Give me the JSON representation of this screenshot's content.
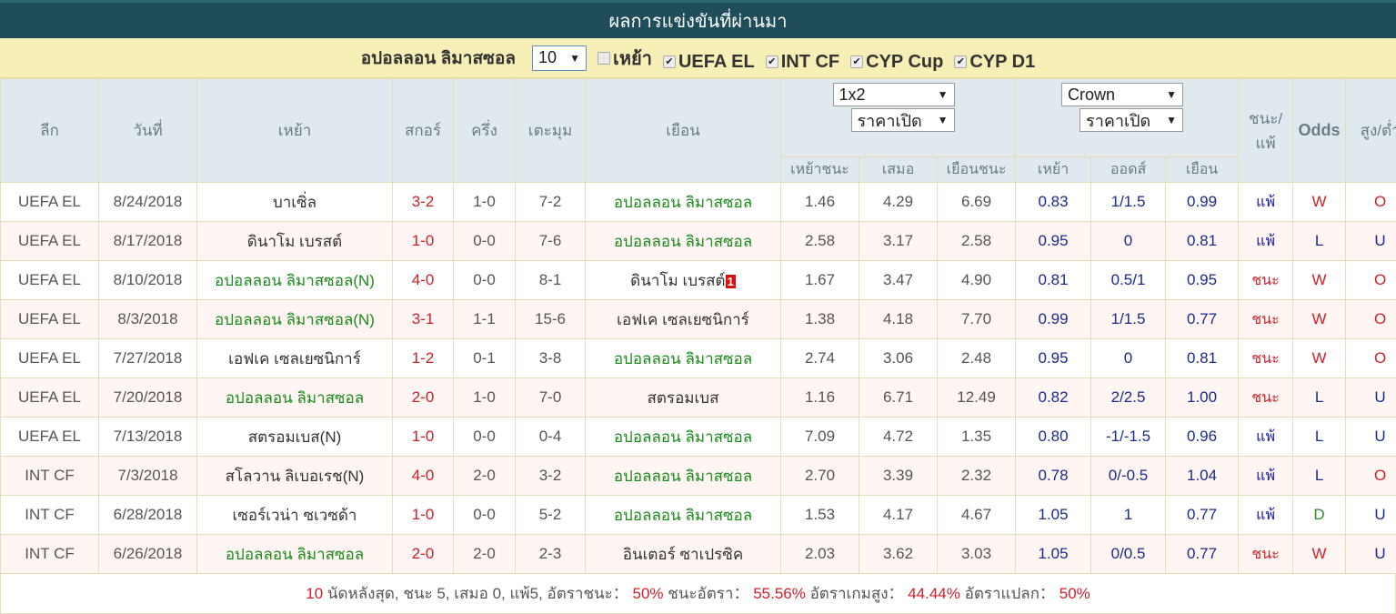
{
  "title": "ผลการแข่งขันที่ผ่านมา",
  "filter": {
    "team": "อปอลลอน ลิมาสซอล",
    "count_value": "10",
    "checkboxes": [
      {
        "label": "เหย้า",
        "checked": false
      },
      {
        "label": "UEFA EL",
        "checked": true
      },
      {
        "label": "INT CF",
        "checked": true
      },
      {
        "label": "CYP Cup",
        "checked": true
      },
      {
        "label": "CYP D1",
        "checked": true
      }
    ]
  },
  "header": {
    "league": "ลีก",
    "date": "วันที่",
    "home": "เหย้า",
    "score": "สกอร์",
    "half": "ครึ่ง",
    "corners": "เตะมุม",
    "away": "เยือน",
    "odds_select_1": "1x2",
    "odds_select_1b": "ราคาเปิด",
    "odds_select_2": "Crown",
    "odds_select_2b": "ราคาเปิด",
    "win_lose": "ชนะ/แพ้",
    "odds": "Odds",
    "over_under": "สูง/ต่ำ",
    "sub": [
      "เหย้าชนะ",
      "เสมอ",
      "เยือนชนะ",
      "เหย้า",
      "ออดส์",
      "เยือน"
    ]
  },
  "rows": [
    {
      "league": "UEFA EL",
      "date": "8/24/2018",
      "home": "บาเซิ่ล",
      "home_hl": false,
      "score": "3-2",
      "half": "1-0",
      "corners": "7-2",
      "away": "อปอลลอน ลิมาสซอล",
      "away_hl": true,
      "badge": "",
      "h": "1.46",
      "d": "4.29",
      "a": "6.69",
      "ah_h": "0.83",
      "ah": "1/1.5",
      "ah_a": "0.99",
      "wl": "แพ้",
      "wl_type": "lose",
      "odds_res": "W",
      "ou": "O"
    },
    {
      "league": "UEFA EL",
      "date": "8/17/2018",
      "home": "ดินาโม เบรสต์",
      "home_hl": false,
      "score": "1-0",
      "half": "0-0",
      "corners": "7-6",
      "away": "อปอลลอน ลิมาสซอล",
      "away_hl": true,
      "badge": "",
      "h": "2.58",
      "d": "3.17",
      "a": "2.58",
      "ah_h": "0.95",
      "ah": "0",
      "ah_a": "0.81",
      "wl": "แพ้",
      "wl_type": "lose",
      "odds_res": "L",
      "ou": "U"
    },
    {
      "league": "UEFA EL",
      "date": "8/10/2018",
      "home": "อปอลลอน ลิมาสซอล(N)",
      "home_hl": true,
      "score": "4-0",
      "half": "0-0",
      "corners": "8-1",
      "away": "ดินาโม เบรสต์",
      "away_hl": false,
      "badge": "1",
      "h": "1.67",
      "d": "3.47",
      "a": "4.90",
      "ah_h": "0.81",
      "ah": "0.5/1",
      "ah_a": "0.95",
      "wl": "ชนะ",
      "wl_type": "win",
      "odds_res": "W",
      "ou": "O"
    },
    {
      "league": "UEFA EL",
      "date": "8/3/2018",
      "home": "อปอลลอน ลิมาสซอล(N)",
      "home_hl": true,
      "score": "3-1",
      "half": "1-1",
      "corners": "15-6",
      "away": "เอฟเค เซลเยซนิการ์",
      "away_hl": false,
      "badge": "",
      "h": "1.38",
      "d": "4.18",
      "a": "7.70",
      "ah_h": "0.99",
      "ah": "1/1.5",
      "ah_a": "0.77",
      "wl": "ชนะ",
      "wl_type": "win",
      "odds_res": "W",
      "ou": "O"
    },
    {
      "league": "UEFA EL",
      "date": "7/27/2018",
      "home": "เอฟเค เซลเยซนิการ์",
      "home_hl": false,
      "score": "1-2",
      "half": "0-1",
      "corners": "3-8",
      "away": "อปอลลอน ลิมาสซอล",
      "away_hl": true,
      "badge": "",
      "h": "2.74",
      "d": "3.06",
      "a": "2.48",
      "ah_h": "0.95",
      "ah": "0",
      "ah_a": "0.81",
      "wl": "ชนะ",
      "wl_type": "win",
      "odds_res": "W",
      "ou": "O"
    },
    {
      "league": "UEFA EL",
      "date": "7/20/2018",
      "home": "อปอลลอน ลิมาสซอล",
      "home_hl": true,
      "score": "2-0",
      "half": "1-0",
      "corners": "7-0",
      "away": "สตรอมเบส",
      "away_hl": false,
      "badge": "",
      "h": "1.16",
      "d": "6.71",
      "a": "12.49",
      "ah_h": "0.82",
      "ah": "2/2.5",
      "ah_a": "1.00",
      "wl": "ชนะ",
      "wl_type": "win",
      "odds_res": "L",
      "ou": "U"
    },
    {
      "league": "UEFA EL",
      "date": "7/13/2018",
      "home": "สตรอมเบส(N)",
      "home_hl": false,
      "score": "1-0",
      "half": "0-0",
      "corners": "0-4",
      "away": "อปอลลอน ลิมาสซอล",
      "away_hl": true,
      "badge": "",
      "h": "7.09",
      "d": "4.72",
      "a": "1.35",
      "ah_h": "0.80",
      "ah": "-1/-1.5",
      "ah_a": "0.96",
      "wl": "แพ้",
      "wl_type": "lose",
      "odds_res": "L",
      "ou": "U"
    },
    {
      "league": "INT CF",
      "date": "7/3/2018",
      "home": "สโลวาน ลิเบอเรช(N)",
      "home_hl": false,
      "score": "4-0",
      "half": "2-0",
      "corners": "3-2",
      "away": "อปอลลอน ลิมาสซอล",
      "away_hl": true,
      "badge": "",
      "h": "2.70",
      "d": "3.39",
      "a": "2.32",
      "ah_h": "0.78",
      "ah": "0/-0.5",
      "ah_a": "1.04",
      "wl": "แพ้",
      "wl_type": "lose",
      "odds_res": "L",
      "ou": "O"
    },
    {
      "league": "INT CF",
      "date": "6/28/2018",
      "home": "เซอร์เวน่า ซเวซด้า",
      "home_hl": false,
      "score": "1-0",
      "half": "0-0",
      "corners": "5-2",
      "away": "อปอลลอน ลิมาสซอล",
      "away_hl": true,
      "badge": "",
      "h": "1.53",
      "d": "4.17",
      "a": "4.67",
      "ah_h": "1.05",
      "ah": "1",
      "ah_a": "0.77",
      "wl": "แพ้",
      "wl_type": "lose",
      "odds_res": "D",
      "ou": "U"
    },
    {
      "league": "INT CF",
      "date": "6/26/2018",
      "home": "อปอลลอน ลิมาสซอล",
      "home_hl": true,
      "score": "2-0",
      "half": "2-0",
      "corners": "2-3",
      "away": "อินเตอร์ ซาเปรซิค",
      "away_hl": false,
      "badge": "",
      "h": "2.03",
      "d": "3.62",
      "a": "3.03",
      "ah_h": "1.05",
      "ah": "0/0.5",
      "ah_a": "0.77",
      "wl": "ชนะ",
      "wl_type": "win",
      "odds_res": "W",
      "ou": "U"
    }
  ],
  "footer": {
    "count": "10",
    "text1": " นัดหลังสุด, ชนะ 5, เสมอ 0, แพ้5, อัตราชนะ： ",
    "win_rate": "50%",
    "text2": " ชนะอัตรา： ",
    "win_odds_rate": "55.56%",
    "text3": " อัตราเกมสูง： ",
    "over_rate": "44.44%",
    "text4": " อัตราแปลก： ",
    "odd_rate": "50%"
  },
  "colors": {
    "title_bg": "#1f4e5a",
    "filter_bg": "#f7f0b6",
    "header_bg": "#dfe9ee",
    "highlight_team": "#1a8a1a",
    "score_red": "#d0202a",
    "odds_blue": "#1b2a8a"
  }
}
